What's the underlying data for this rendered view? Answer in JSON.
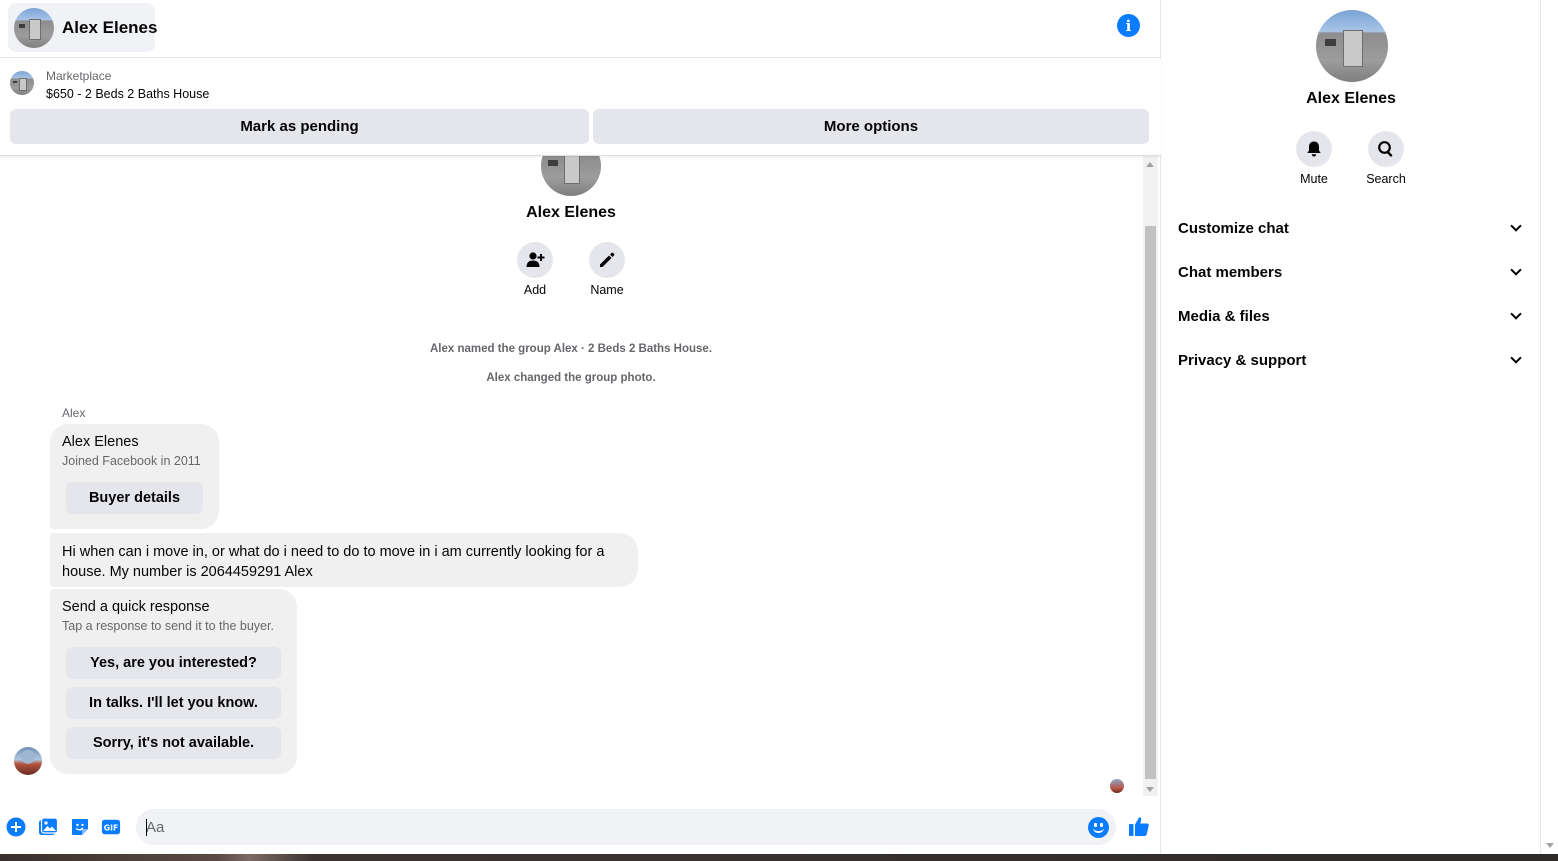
{
  "header": {
    "contact_name": "Alex Elenes",
    "info_icon": "info-icon"
  },
  "marketplace": {
    "label": "Marketplace",
    "listing_title": "$650 - 2 Beds 2 Baths House",
    "mark_pending_label": "Mark as pending",
    "more_options_label": "More options"
  },
  "thread": {
    "name": "Alex Elenes",
    "actions": [
      {
        "label": "Add",
        "icon": "add-person-icon"
      },
      {
        "label": "Name",
        "icon": "pencil-icon"
      }
    ],
    "system_messages": [
      "Alex named the group Alex · 2 Beds 2 Baths House.",
      "Alex changed the group photo."
    ],
    "sender_label": "Alex",
    "profile_card": {
      "name": "Alex Elenes",
      "subtitle": "Joined Facebook in 2011",
      "button": "Buyer details"
    },
    "message_text": "Hi when can i move in, or what do i need to do to move in i am currently looking for a house. My number is 2064459291 Alex",
    "quick_response": {
      "title": "Send a quick response",
      "subtitle": "Tap a response to send it to the buyer.",
      "options": [
        "Yes, are you interested?",
        "In talks. I'll let you know.",
        "Sorry, it's not available."
      ]
    }
  },
  "composer": {
    "placeholder": "Aa",
    "icons": [
      "plus-icon",
      "image-icon",
      "sticker-icon",
      "gif-icon"
    ],
    "gif_label": "GIF",
    "emoji_icon": "emoji-icon",
    "like_icon": "thumbs-up-icon"
  },
  "panel": {
    "name": "Alex Elenes",
    "actions": [
      {
        "label": "Mute",
        "icon": "bell-icon"
      },
      {
        "label": "Search",
        "icon": "search-icon"
      }
    ],
    "sections": [
      "Customize chat",
      "Chat members",
      "Media & files",
      "Privacy & support"
    ]
  },
  "colors": {
    "accent": "#0a7cff",
    "bubble": "#f0f0f0",
    "button": "#e4e6eb",
    "secondary_text": "#65676b"
  }
}
